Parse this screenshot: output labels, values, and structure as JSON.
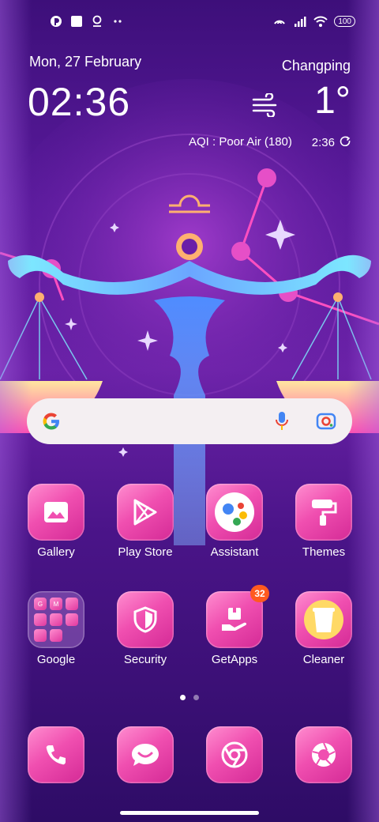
{
  "status_bar": {
    "left_icons": [
      "app-notification-icon",
      "square-notification-icon",
      "location-pin-icon",
      "more-dots-icon"
    ],
    "right_icons": [
      "hotspot-icon",
      "signal-icon",
      "wifi-icon"
    ],
    "battery": "100"
  },
  "clock_widget": {
    "date": "Mon, 27 February",
    "time": "02:36",
    "location": "Changping",
    "temperature": "1°",
    "weather_icon": "wind-icon",
    "aqi": "AQI : Poor Air (180)",
    "updated_time": "2:36"
  },
  "search_bar": {
    "logo": "google-g-icon",
    "mic_icon": "mic-icon",
    "lens_icon": "lens-camera-icon"
  },
  "apps": [
    {
      "label": "Gallery",
      "icon": "gallery-icon"
    },
    {
      "label": "Play Store",
      "icon": "play-store-icon"
    },
    {
      "label": "Assistant",
      "icon": "assistant-icon"
    },
    {
      "label": "Themes",
      "icon": "paint-roller-icon"
    },
    {
      "label": "Google",
      "icon": "folder-icon"
    },
    {
      "label": "Security",
      "icon": "shield-icon"
    },
    {
      "label": "GetApps",
      "icon": "getapps-icon",
      "badge": "32"
    },
    {
      "label": "Cleaner",
      "icon": "trash-bin-icon"
    }
  ],
  "google_folder_letters": [
    "G",
    "M",
    "",
    "",
    "",
    "",
    "",
    ""
  ],
  "dock": [
    {
      "icon": "phone-icon"
    },
    {
      "icon": "messages-icon"
    },
    {
      "icon": "browser-icon"
    },
    {
      "icon": "camera-icon"
    }
  ],
  "page_indicator": {
    "pages": 2,
    "current": 1
  },
  "colors": {
    "icon_pink": "#f04fb0",
    "badge": "#ff5a1f",
    "background": "#5a1a9c"
  }
}
